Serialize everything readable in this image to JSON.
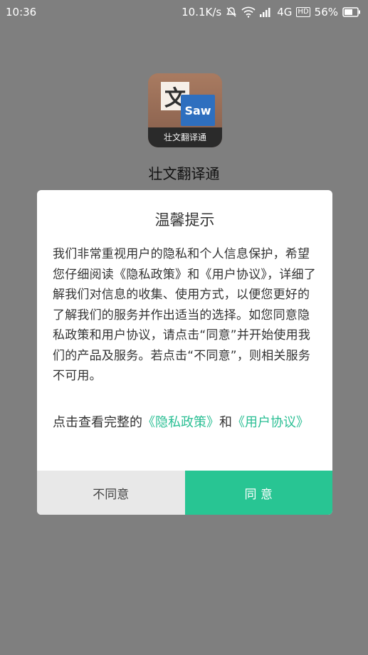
{
  "status_bar": {
    "time": "10:36",
    "network_speed": "10.1K/s",
    "network_type": "4G",
    "hd_badge": "HD",
    "battery": "56%"
  },
  "app": {
    "icon_text_top_left": "文",
    "icon_text_right": "Saw",
    "icon_label": "壮文翻译通",
    "name": "壮文翻译通"
  },
  "dialog": {
    "title": "温馨提示",
    "body": "我们非常重视用户的隐私和个人信息保护，希望您仔细阅读《隐私政策》和《用户协议》，详细了解我们对信息的收集、使用方式，以便您更好的了解我们的服务并作出适当的选择。如您同意隐私政策和用户协议，请点击“同意”并开始使用我们的产品及服务。若点击“不同意”，则相关服务不可用。",
    "links_prefix": "点击查看完整的",
    "privacy_link": "《隐私政策》",
    "links_and": "和",
    "terms_link": "《用户协议》",
    "disagree": "不同意",
    "agree": "同 意"
  },
  "colors": {
    "accent": "#28c593",
    "link": "#2bbf94",
    "overlay": "#7f7f7f"
  }
}
